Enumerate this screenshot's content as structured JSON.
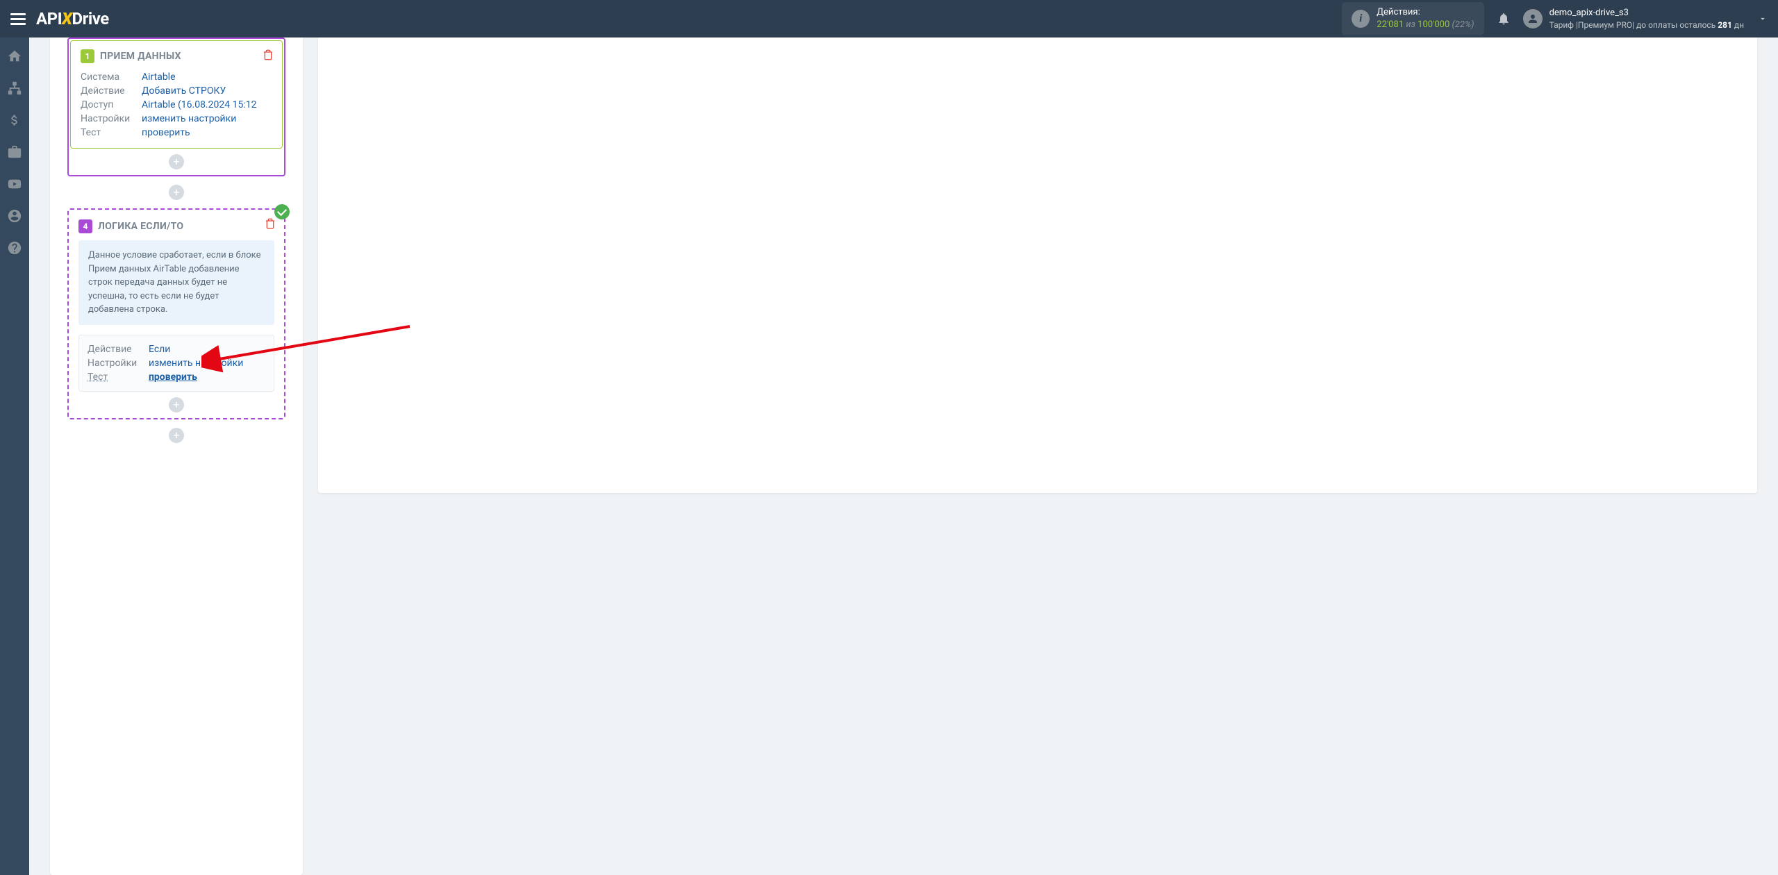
{
  "header": {
    "logo_ap": "API",
    "logo_x": "X",
    "logo_drive": "Drive",
    "actions_label": "Действия:",
    "actions_count": "22'081",
    "actions_iz": " из ",
    "actions_total": "100'000",
    "actions_pct": " (22%)",
    "username": "demo_apix-drive_s3",
    "tariff_text": "Тариф |Премиум PRO| до оплаты осталось ",
    "days_count": "281",
    "days_suffix": " дн"
  },
  "block1": {
    "badge": "1",
    "title": "ПРИЕМ ДАННЫХ",
    "rows": {
      "system_k": "Система",
      "system_v": "Airtable",
      "action_k": "Действие",
      "action_v": "Добавить СТРОКУ",
      "access_k": "Доступ",
      "access_v": "Airtable (16.08.2024 15:12",
      "settings_k": "Настройки",
      "settings_v": "изменить настройки",
      "test_k": "Тест",
      "test_v": "проверить"
    }
  },
  "block2": {
    "badge": "4",
    "title": "ЛОГИКА ЕСЛИ/ТО",
    "condition_text": "Данное условие сработает, если в блоке Прием данных AirTable добавление строк передача данных будет не успешна, то есть если не будет добавлена строка.",
    "rows": {
      "action_k": "Действие",
      "action_v": "Если",
      "settings_k": "Настройки",
      "settings_v": "изменить настройки",
      "test_k": "Тест",
      "test_v": "проверить"
    }
  }
}
